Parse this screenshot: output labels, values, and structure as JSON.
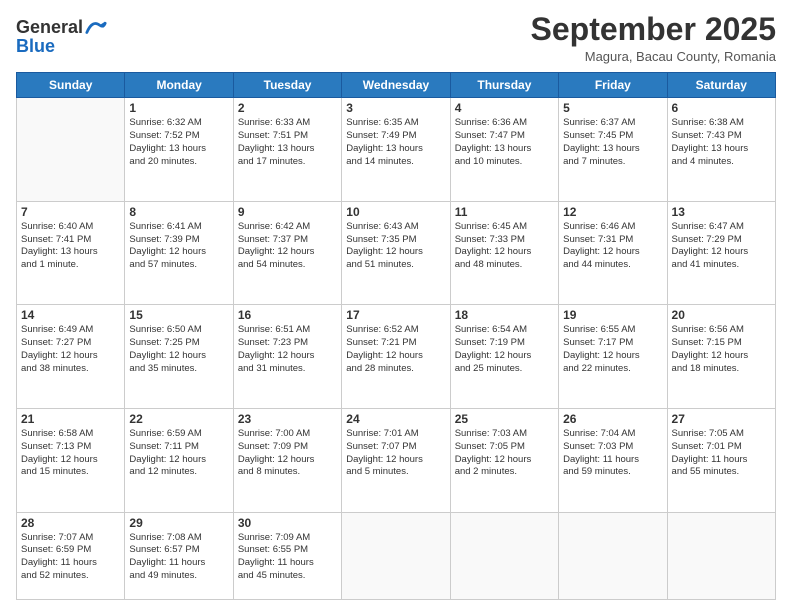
{
  "header": {
    "logo": {
      "line1": "General",
      "line2": "Blue"
    },
    "title": "September 2025",
    "location": "Magura, Bacau County, Romania"
  },
  "weekdays": [
    "Sunday",
    "Monday",
    "Tuesday",
    "Wednesday",
    "Thursday",
    "Friday",
    "Saturday"
  ],
  "weeks": [
    [
      {
        "day": "",
        "info": ""
      },
      {
        "day": "1",
        "info": "Sunrise: 6:32 AM\nSunset: 7:52 PM\nDaylight: 13 hours\nand 20 minutes."
      },
      {
        "day": "2",
        "info": "Sunrise: 6:33 AM\nSunset: 7:51 PM\nDaylight: 13 hours\nand 17 minutes."
      },
      {
        "day": "3",
        "info": "Sunrise: 6:35 AM\nSunset: 7:49 PM\nDaylight: 13 hours\nand 14 minutes."
      },
      {
        "day": "4",
        "info": "Sunrise: 6:36 AM\nSunset: 7:47 PM\nDaylight: 13 hours\nand 10 minutes."
      },
      {
        "day": "5",
        "info": "Sunrise: 6:37 AM\nSunset: 7:45 PM\nDaylight: 13 hours\nand 7 minutes."
      },
      {
        "day": "6",
        "info": "Sunrise: 6:38 AM\nSunset: 7:43 PM\nDaylight: 13 hours\nand 4 minutes."
      }
    ],
    [
      {
        "day": "7",
        "info": "Sunrise: 6:40 AM\nSunset: 7:41 PM\nDaylight: 13 hours\nand 1 minute."
      },
      {
        "day": "8",
        "info": "Sunrise: 6:41 AM\nSunset: 7:39 PM\nDaylight: 12 hours\nand 57 minutes."
      },
      {
        "day": "9",
        "info": "Sunrise: 6:42 AM\nSunset: 7:37 PM\nDaylight: 12 hours\nand 54 minutes."
      },
      {
        "day": "10",
        "info": "Sunrise: 6:43 AM\nSunset: 7:35 PM\nDaylight: 12 hours\nand 51 minutes."
      },
      {
        "day": "11",
        "info": "Sunrise: 6:45 AM\nSunset: 7:33 PM\nDaylight: 12 hours\nand 48 minutes."
      },
      {
        "day": "12",
        "info": "Sunrise: 6:46 AM\nSunset: 7:31 PM\nDaylight: 12 hours\nand 44 minutes."
      },
      {
        "day": "13",
        "info": "Sunrise: 6:47 AM\nSunset: 7:29 PM\nDaylight: 12 hours\nand 41 minutes."
      }
    ],
    [
      {
        "day": "14",
        "info": "Sunrise: 6:49 AM\nSunset: 7:27 PM\nDaylight: 12 hours\nand 38 minutes."
      },
      {
        "day": "15",
        "info": "Sunrise: 6:50 AM\nSunset: 7:25 PM\nDaylight: 12 hours\nand 35 minutes."
      },
      {
        "day": "16",
        "info": "Sunrise: 6:51 AM\nSunset: 7:23 PM\nDaylight: 12 hours\nand 31 minutes."
      },
      {
        "day": "17",
        "info": "Sunrise: 6:52 AM\nSunset: 7:21 PM\nDaylight: 12 hours\nand 28 minutes."
      },
      {
        "day": "18",
        "info": "Sunrise: 6:54 AM\nSunset: 7:19 PM\nDaylight: 12 hours\nand 25 minutes."
      },
      {
        "day": "19",
        "info": "Sunrise: 6:55 AM\nSunset: 7:17 PM\nDaylight: 12 hours\nand 22 minutes."
      },
      {
        "day": "20",
        "info": "Sunrise: 6:56 AM\nSunset: 7:15 PM\nDaylight: 12 hours\nand 18 minutes."
      }
    ],
    [
      {
        "day": "21",
        "info": "Sunrise: 6:58 AM\nSunset: 7:13 PM\nDaylight: 12 hours\nand 15 minutes."
      },
      {
        "day": "22",
        "info": "Sunrise: 6:59 AM\nSunset: 7:11 PM\nDaylight: 12 hours\nand 12 minutes."
      },
      {
        "day": "23",
        "info": "Sunrise: 7:00 AM\nSunset: 7:09 PM\nDaylight: 12 hours\nand 8 minutes."
      },
      {
        "day": "24",
        "info": "Sunrise: 7:01 AM\nSunset: 7:07 PM\nDaylight: 12 hours\nand 5 minutes."
      },
      {
        "day": "25",
        "info": "Sunrise: 7:03 AM\nSunset: 7:05 PM\nDaylight: 12 hours\nand 2 minutes."
      },
      {
        "day": "26",
        "info": "Sunrise: 7:04 AM\nSunset: 7:03 PM\nDaylight: 11 hours\nand 59 minutes."
      },
      {
        "day": "27",
        "info": "Sunrise: 7:05 AM\nSunset: 7:01 PM\nDaylight: 11 hours\nand 55 minutes."
      }
    ],
    [
      {
        "day": "28",
        "info": "Sunrise: 7:07 AM\nSunset: 6:59 PM\nDaylight: 11 hours\nand 52 minutes."
      },
      {
        "day": "29",
        "info": "Sunrise: 7:08 AM\nSunset: 6:57 PM\nDaylight: 11 hours\nand 49 minutes."
      },
      {
        "day": "30",
        "info": "Sunrise: 7:09 AM\nSunset: 6:55 PM\nDaylight: 11 hours\nand 45 minutes."
      },
      {
        "day": "",
        "info": ""
      },
      {
        "day": "",
        "info": ""
      },
      {
        "day": "",
        "info": ""
      },
      {
        "day": "",
        "info": ""
      }
    ]
  ]
}
